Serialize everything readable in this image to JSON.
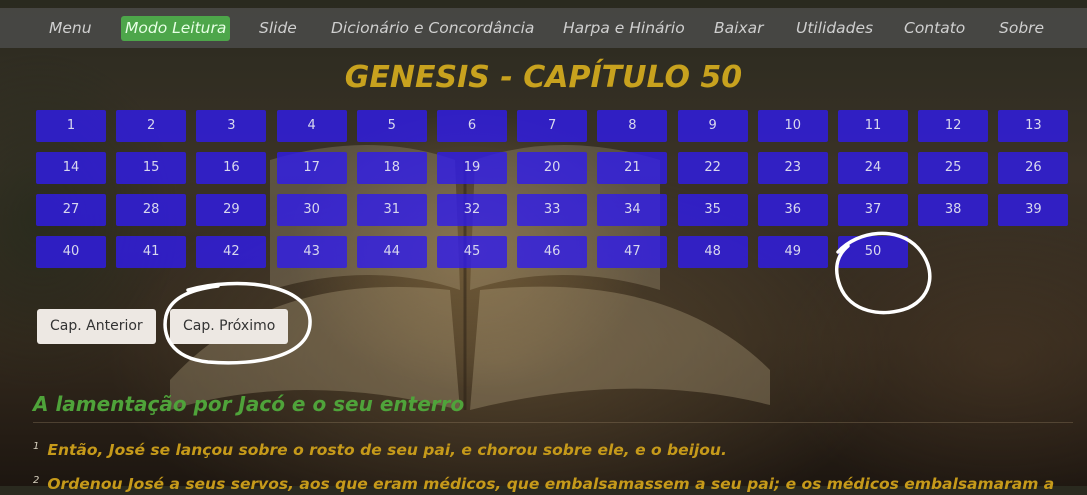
{
  "nav": {
    "items": [
      {
        "label": "Menu",
        "active": false
      },
      {
        "label": "Modo Leitura",
        "active": true
      },
      {
        "label": "Slide",
        "active": false
      },
      {
        "label": "Dicionário e Concordância",
        "active": false
      },
      {
        "label": "Harpa e Hinário",
        "active": false
      },
      {
        "label": "Baixar",
        "active": false
      },
      {
        "label": "Utilidades",
        "active": false
      },
      {
        "label": "Contato",
        "active": false
      },
      {
        "label": "Sobre",
        "active": false
      }
    ]
  },
  "title": "GENESIS - CAPÍTULO 50",
  "chapters": [
    "1",
    "2",
    "3",
    "4",
    "5",
    "6",
    "7",
    "8",
    "9",
    "10",
    "11",
    "12",
    "13",
    "14",
    "15",
    "16",
    "17",
    "18",
    "19",
    "20",
    "21",
    "22",
    "23",
    "24",
    "25",
    "26",
    "27",
    "28",
    "29",
    "30",
    "31",
    "32",
    "33",
    "34",
    "35",
    "36",
    "37",
    "38",
    "39",
    "40",
    "41",
    "42",
    "43",
    "44",
    "45",
    "46",
    "47",
    "48",
    "49",
    "50"
  ],
  "current_chapter": "50",
  "buttons": {
    "previous": "Cap. Anterior",
    "next": "Cap. Próximo"
  },
  "section_heading": "A lamentação por Jacó e o seu enterro",
  "verses": [
    {
      "num": "1",
      "text": "Então, José se lançou sobre o rosto de seu pai, e chorou sobre ele, e o beijou."
    },
    {
      "num": "2",
      "text": "Ordenou José a seus servos, aos que eram médicos, que embalsamassem a seu pai; e os médicos embalsamaram a"
    }
  ],
  "colors": {
    "chapter_button": "#301cebcc",
    "title": "#c8a21e",
    "heading": "#4fa33a",
    "verse_text": "#c69a1a",
    "nav_active": "#4da64a"
  }
}
